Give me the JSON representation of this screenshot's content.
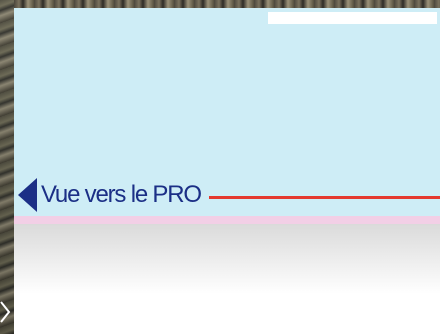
{
  "nav": {
    "back_label": "Vue vers le PRO",
    "back_icon": "triangle-left-icon"
  },
  "colors": {
    "panel": "#ceedf6",
    "accent_navy": "#1b2f86",
    "accent_red": "#e4392f",
    "pink": "#f2cfe6"
  },
  "icons": {
    "next": "chevron-right-icon"
  }
}
